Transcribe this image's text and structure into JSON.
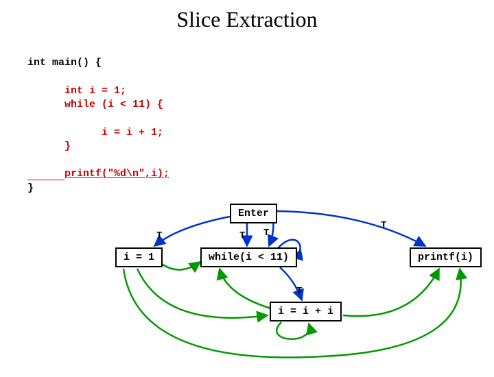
{
  "title": "Slice Extraction",
  "code": {
    "l1": "int main() {",
    "l2": "",
    "l3": "      int i = 1;",
    "l4": "      while (i < 11) {",
    "l5": "",
    "l6": "            i = i + 1;",
    "l7": "      }",
    "l8": "",
    "l9": "printf(\"%d\\n\",i);",
    "l10": "}"
  },
  "nodes": {
    "enter": "Enter",
    "init": "i = 1",
    "cond": "while(i < 11)",
    "incr": "i = i + i",
    "print": "printf(i)"
  },
  "edge_labels": {
    "t1": "T",
    "t2": "T",
    "t3": "T",
    "t4": "T",
    "t5": "T"
  },
  "colors": {
    "red": "#cc0000",
    "green": "#009900",
    "blue": "#0033cc"
  }
}
